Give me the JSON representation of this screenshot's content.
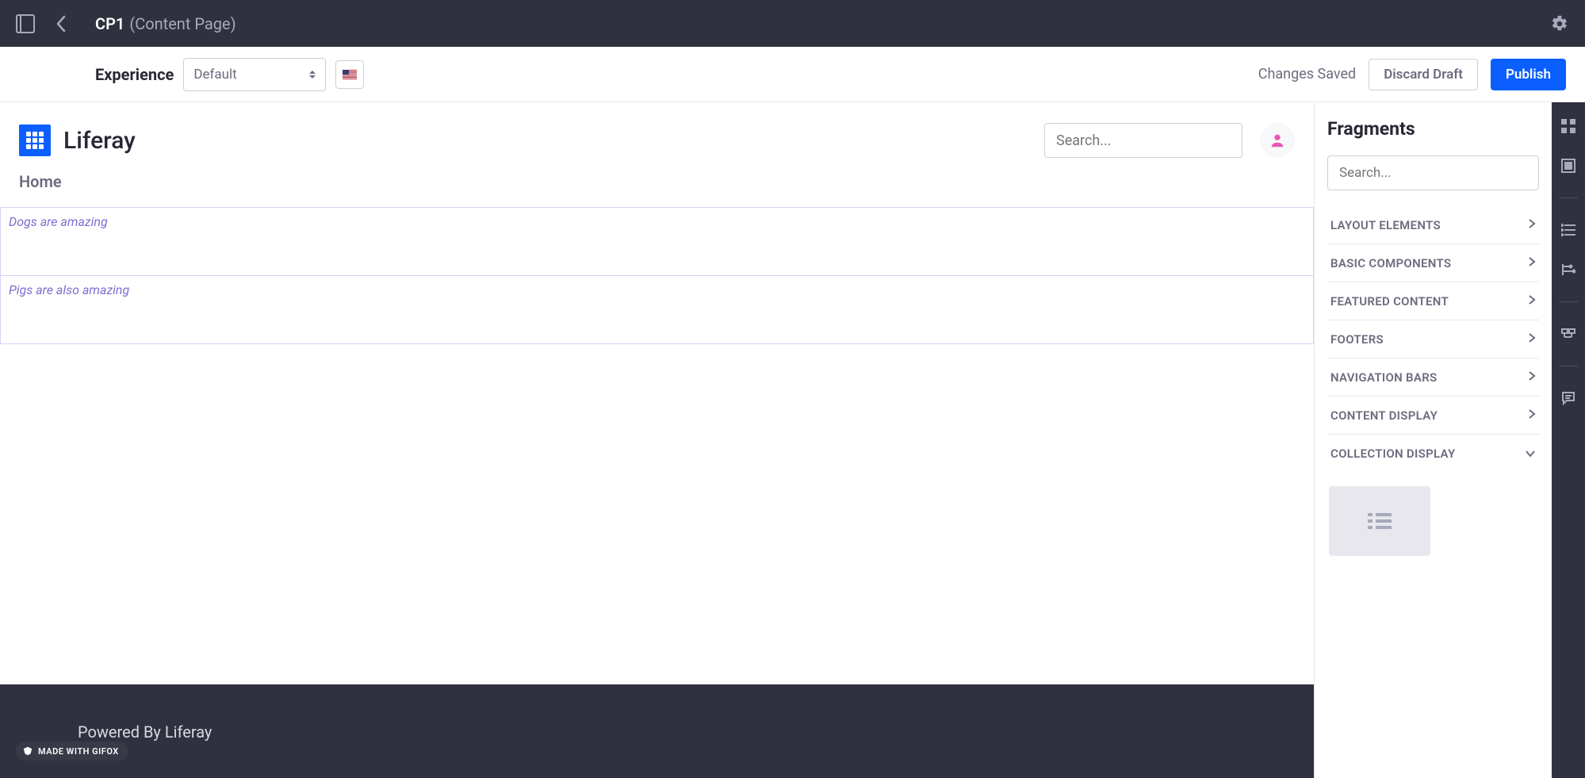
{
  "header": {
    "page_name": "CP1",
    "page_type": "(Content Page)"
  },
  "experience": {
    "label": "Experience",
    "selected": "Default",
    "locale": "en-US",
    "saved_text": "Changes Saved",
    "discard_label": "Discard Draft",
    "publish_label": "Publish"
  },
  "site": {
    "name": "Liferay",
    "search_placeholder": "Search...",
    "nav_home": "Home",
    "footer_text": "Powered By Liferay"
  },
  "blocks": [
    {
      "text": "Dogs are amazing"
    },
    {
      "text": "Pigs are also amazing"
    }
  ],
  "fragments": {
    "title": "Fragments",
    "search_placeholder": "Search...",
    "categories": [
      {
        "label": "LAYOUT ELEMENTS",
        "expanded": false
      },
      {
        "label": "BASIC COMPONENTS",
        "expanded": false
      },
      {
        "label": "FEATURED CONTENT",
        "expanded": false
      },
      {
        "label": "FOOTERS",
        "expanded": false
      },
      {
        "label": "NAVIGATION BARS",
        "expanded": false
      },
      {
        "label": "CONTENT DISPLAY",
        "expanded": false
      },
      {
        "label": "COLLECTION DISPLAY",
        "expanded": true
      }
    ]
  },
  "gifox": {
    "label": "MADE WITH GIFOX"
  }
}
